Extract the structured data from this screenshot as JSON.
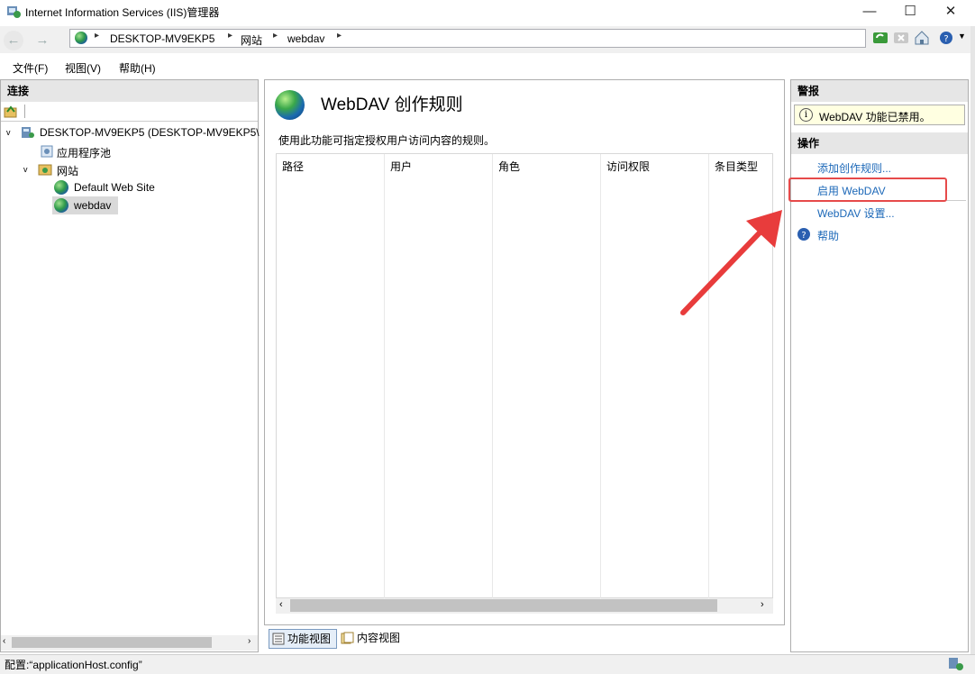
{
  "window": {
    "title": "Internet Information Services (IIS)管理器",
    "min": "—",
    "max": "☐",
    "close": "✕"
  },
  "address": {
    "crumbs": [
      "DESKTOP-MV9EKP5",
      "网站",
      "webdav"
    ],
    "arrow": "▸"
  },
  "menu": [
    "文件(F)",
    "视图(V)",
    "帮助(H)"
  ],
  "connections": {
    "header": "连接",
    "tree": {
      "root": "DESKTOP-MV9EKP5 (DESKTOP-MV9EKP5\\",
      "app_pools": "应用程序池",
      "sites": "网站",
      "default_site": "Default Web Site",
      "webdav": "webdav"
    }
  },
  "main": {
    "title": "WebDAV 创作规则",
    "description": "使用此功能可指定授权用户访问内容的规则。",
    "columns": [
      "路径",
      "用户",
      "角色",
      "访问权限",
      "条目类型"
    ],
    "tabs": [
      "功能视图",
      "内容视图"
    ]
  },
  "actions": {
    "alerts_header": "警报",
    "alert_text": "WebDAV 功能已禁用。",
    "ops_header": "操作",
    "items": [
      "添加创作规则...",
      "启用 WebDAV",
      "WebDAV 设置...",
      "帮助"
    ],
    "accent": "#1c68b8",
    "highlight_color": "#e64a4a"
  },
  "status": {
    "text": "配置:“applicationHost.config”"
  }
}
